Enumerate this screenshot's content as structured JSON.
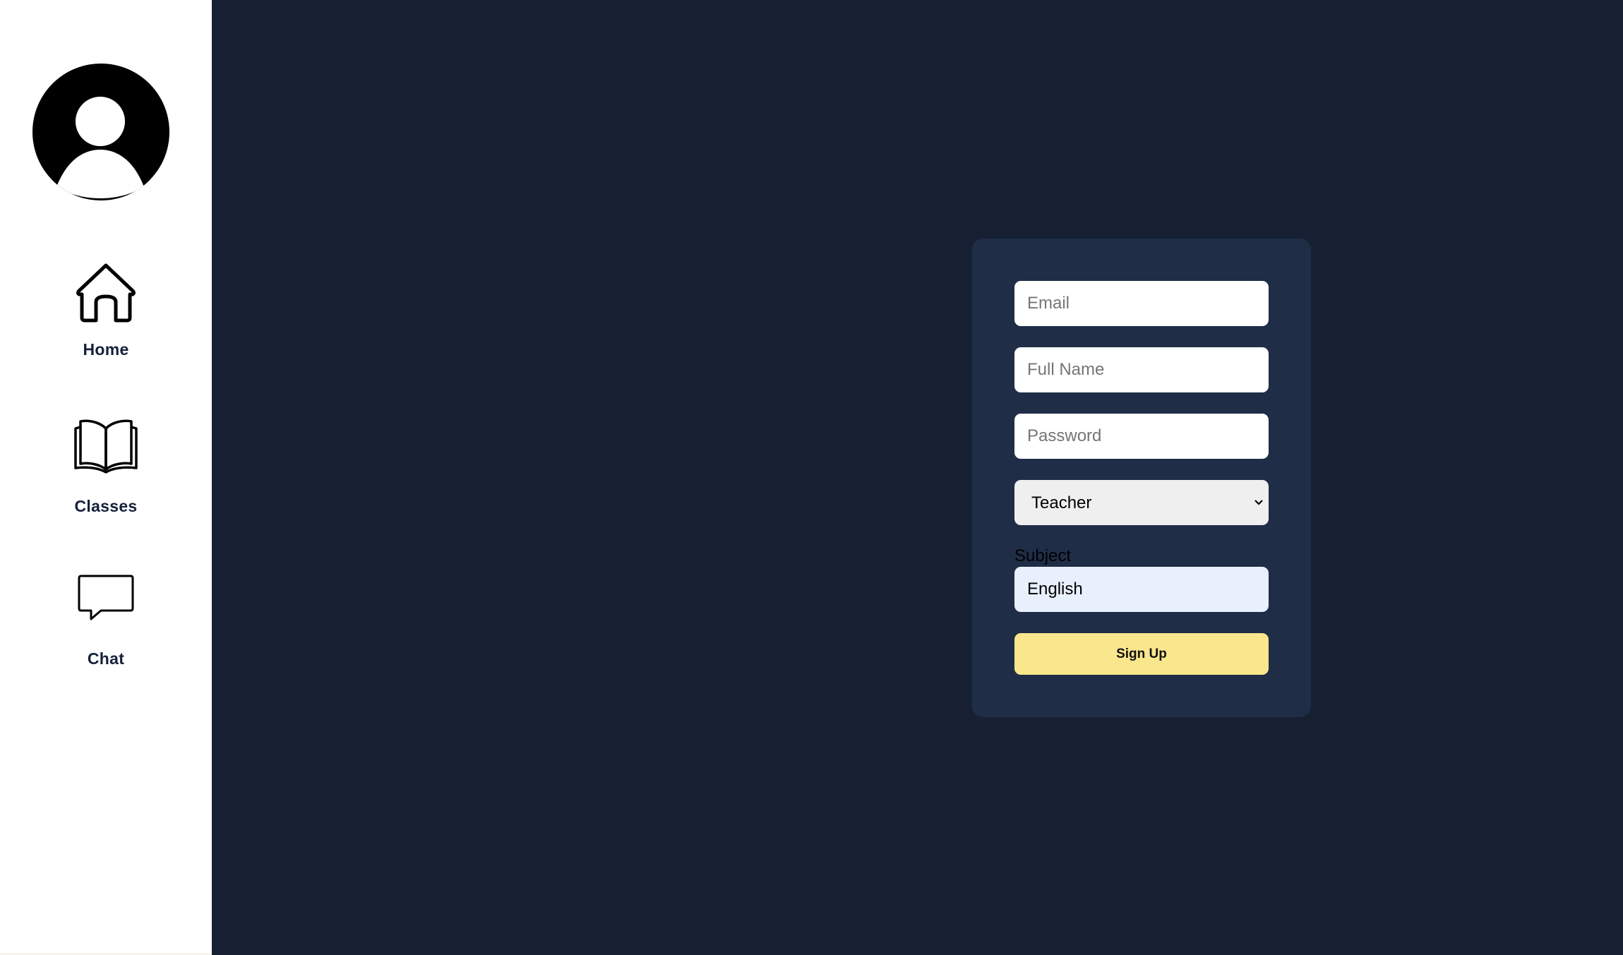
{
  "sidebar": {
    "avatar_icon": "user-avatar-icon",
    "items": [
      {
        "label": "Home",
        "icon": "home-icon"
      },
      {
        "label": "Classes",
        "icon": "book-icon"
      },
      {
        "label": "Chat",
        "icon": "chat-bubble-icon"
      }
    ]
  },
  "form": {
    "email": {
      "placeholder": "Email",
      "value": ""
    },
    "full_name": {
      "placeholder": "Full Name",
      "value": ""
    },
    "password": {
      "placeholder": "Password",
      "value": ""
    },
    "role": {
      "selected": "Teacher"
    },
    "subject": {
      "label": "Subject",
      "value": "English"
    },
    "submit_label": "Sign Up"
  },
  "colors": {
    "page_background": "#162032",
    "card_background": "#1f2d47",
    "sidebar_background": "#ffffff",
    "nav_label": "#15213a",
    "button_background": "#fae68d",
    "autofill_background": "#e8f0fe"
  }
}
